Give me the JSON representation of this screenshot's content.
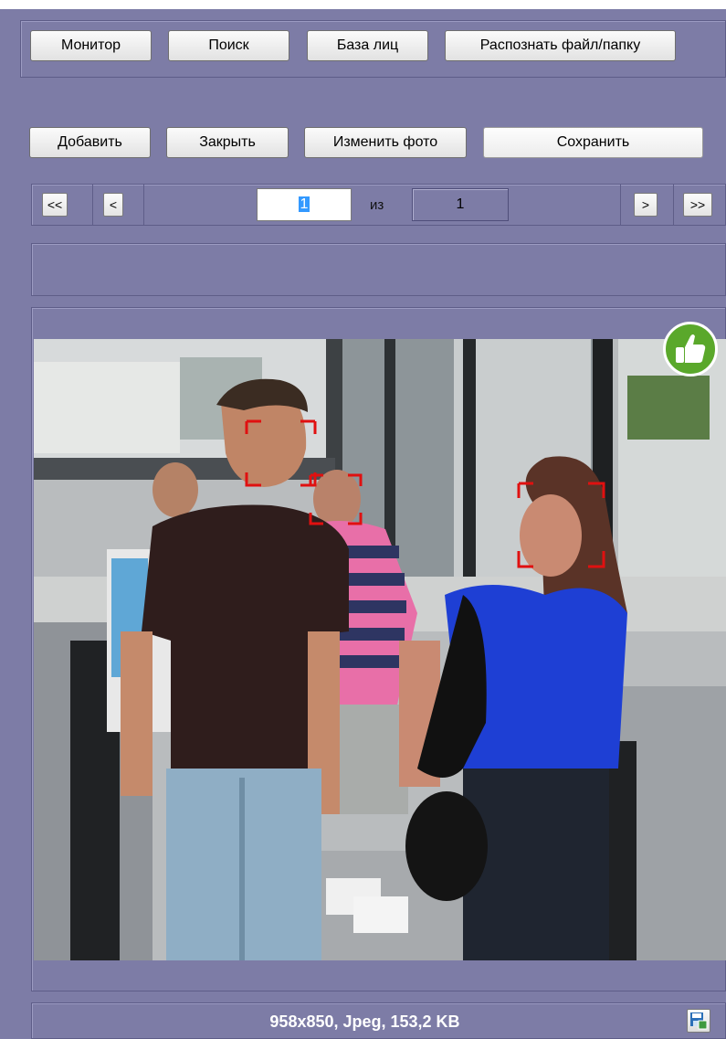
{
  "toolbar": {
    "monitor_label": "Монитор",
    "search_label": "Поиск",
    "faces_db_label": "База лиц",
    "recognize_label": "Распознать файл/папку"
  },
  "editor": {
    "add_label": "Добавить",
    "close_label": "Закрыть",
    "change_photo_label": "Изменить фото",
    "save_label": "Сохранить"
  },
  "pager": {
    "first_label": "<<",
    "prev_label": "<",
    "current_page": "1",
    "of_label": "из",
    "total_pages": "1",
    "next_label": ">",
    "last_label": ">>"
  },
  "photo": {
    "faces_detected": 3,
    "frame_color": "#e01010",
    "status_icon": "thumbs-up-icon",
    "status_color": "#5aa82b"
  },
  "status": {
    "info": "958x850, Jpeg, 153,2 KB",
    "save_icon": "save-icon"
  }
}
